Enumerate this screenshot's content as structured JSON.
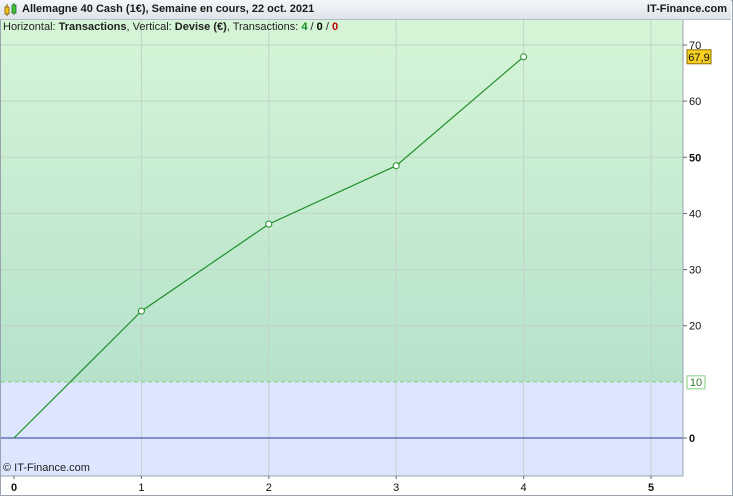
{
  "header": {
    "title": "Allemagne 40 Cash (1€), Semaine en cours, 22 oct. 2021",
    "brand": "IT-Finance.com"
  },
  "subtitle": {
    "h_label": "Horizontal: ",
    "h_value": "Transactions",
    "v_label": ", Vertical: ",
    "v_value": "Devise (€)",
    "t_label": ", Transactions: ",
    "t_green": "4",
    "sep1": " / ",
    "t_black": "0",
    "sep2": " / ",
    "t_red": "0"
  },
  "footer": {
    "copyright": "© IT-Finance.com"
  },
  "colors": {
    "upper_top": "#d6f5d6",
    "upper_bottom": "#b6e2cc",
    "lower_zone": "#dde6ff",
    "line": "#1f8f2a",
    "zero_line": "#2b3a9a",
    "threshold": "#7fcf7f",
    "last_badge": "#f6cf1f"
  },
  "chart_data": {
    "type": "line",
    "title": "Allemagne 40 Cash (1€), Semaine en cours, 22 oct. 2021",
    "xlabel": "Transactions",
    "ylabel": "Devise (€)",
    "x": [
      0,
      1,
      2,
      3,
      4
    ],
    "y": [
      0,
      22.6,
      38.1,
      48.5,
      67.9
    ],
    "xlim": [
      0,
      5.25
    ],
    "ylim": [
      -6.5,
      75
    ],
    "x_ticks": [
      0,
      1,
      2,
      3,
      4,
      5
    ],
    "x_tick_labels": [
      "0",
      "1",
      "2",
      "3",
      "4",
      "5"
    ],
    "y_ticks": [
      0,
      20,
      30,
      40,
      50,
      60,
      70
    ],
    "y_tick_labels": [
      "0",
      "20",
      "30",
      "40",
      "50",
      "60",
      "70"
    ],
    "threshold": 10,
    "threshold_label": "10",
    "last_value_label": "67,9",
    "grid": true,
    "axis_position": "right"
  }
}
